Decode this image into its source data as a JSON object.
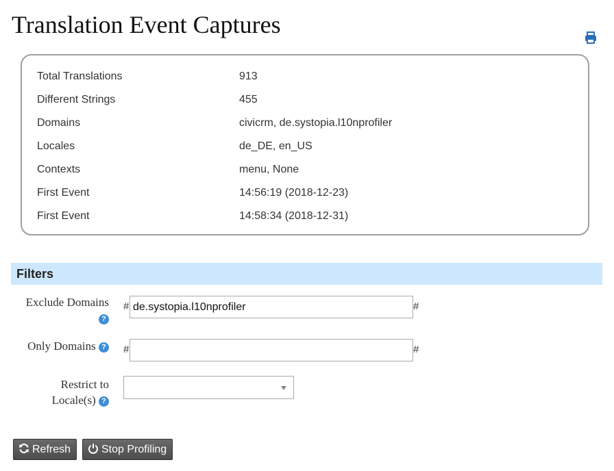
{
  "page": {
    "title": "Translation Event Captures"
  },
  "icons": {
    "print": "print-icon",
    "help": "help-icon",
    "refresh": "refresh-icon",
    "power": "power-icon",
    "dropdown": "chevron-down-icon"
  },
  "colors": {
    "filters_header_bg": "#cde8fe",
    "help_icon": "#3e8ed6",
    "print_icon": "#2a6fb6",
    "button_bg": "#5a5a5a"
  },
  "stats": [
    {
      "label": "Total Translations",
      "value": "913"
    },
    {
      "label": "Different Strings",
      "value": "455"
    },
    {
      "label": "Domains",
      "value": "civicrm, de.systopia.l10nprofiler"
    },
    {
      "label": "Locales",
      "value": "de_DE, en_US"
    },
    {
      "label": "Contexts",
      "value": "menu, None"
    },
    {
      "label": "First Event",
      "value": "14:56:19 (2018-12-23)"
    },
    {
      "label": "First Event",
      "value": "14:58:34 (2018-12-31)"
    }
  ],
  "filters": {
    "header": "Filters",
    "exclude_domains": {
      "label": "Exclude Domains",
      "value": "de.systopia.l10nprofiler",
      "prefix": "#",
      "suffix": "#"
    },
    "only_domains": {
      "label": "Only Domains",
      "value": "",
      "prefix": "#",
      "suffix": "#"
    },
    "restrict_locales": {
      "label_line1": "Restrict to",
      "label_line2": "Locale(s)",
      "value": ""
    },
    "help_glyph": "?"
  },
  "buttons": {
    "refresh": "Refresh",
    "stop_profiling": "Stop Profiling"
  }
}
